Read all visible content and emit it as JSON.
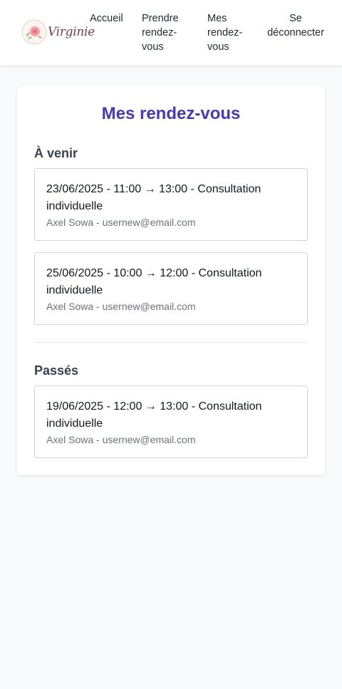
{
  "brand": {
    "name": "Virginie",
    "logo_icon": "rose-logo-icon"
  },
  "nav": {
    "accueil": "Accueil",
    "prendre": "Prendre rendez-vous",
    "mes": "Mes rendez-vous",
    "deconnecter": "Se déconnecter"
  },
  "page": {
    "title": "Mes rendez-vous"
  },
  "sections": {
    "upcoming": {
      "title": "À venir",
      "items": [
        {
          "summary": "23/06/2025 - 11:00 → 13:00 - Consultation individuelle",
          "client": "Axel Sowa - usernew@email.com"
        },
        {
          "summary": "25/06/2025 - 10:00 → 12:00 - Consultation individuelle",
          "client": "Axel Sowa - usernew@email.com"
        }
      ]
    },
    "past": {
      "title": "Passés",
      "items": [
        {
          "summary": "19/06/2025 - 12:00 → 13:00 - Consultation individuelle",
          "client": "Axel Sowa - usernew@email.com"
        }
      ]
    }
  },
  "colors": {
    "accent": "#4338ca",
    "background": "#f9fafb"
  }
}
